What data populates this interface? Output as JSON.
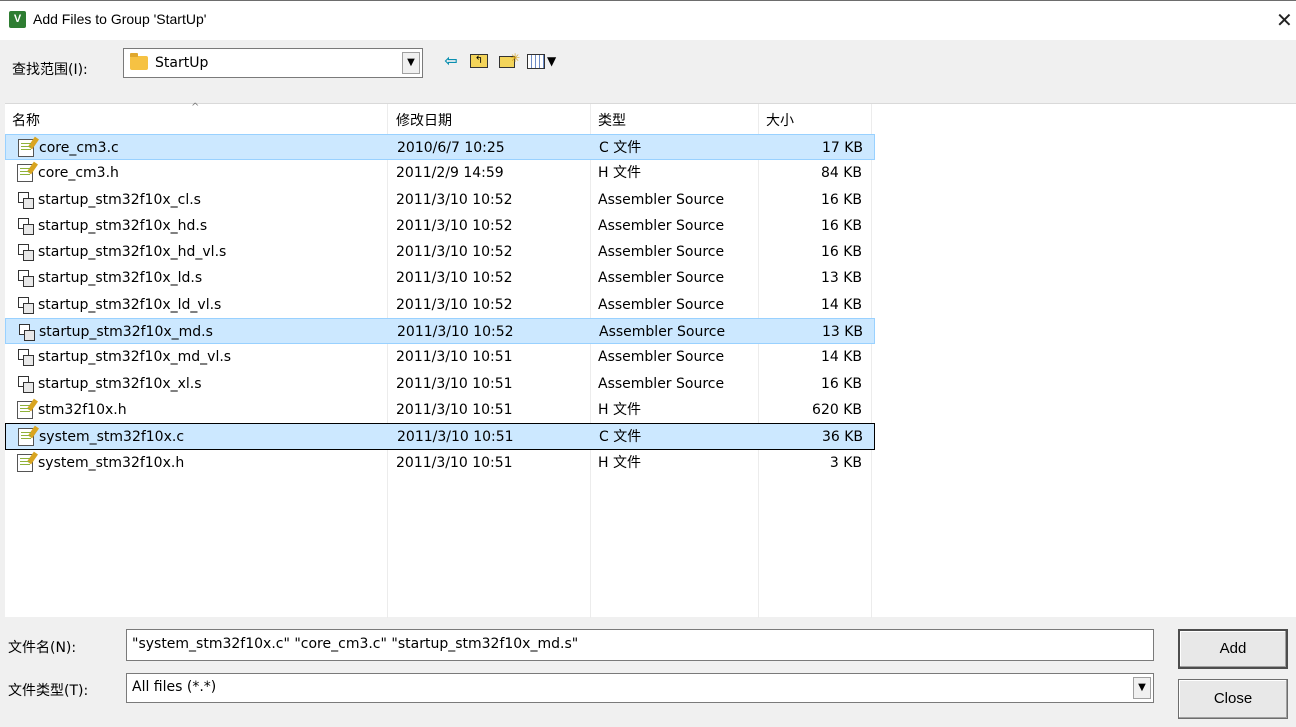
{
  "window": {
    "title": "Add Files to Group 'StartUp'",
    "app_icon_letter": "V",
    "close_glyph": "✕"
  },
  "toolbar": {
    "lookin_label": "查找范围(I):",
    "lookin_value": "StartUp",
    "back_icon": "back-arrow-icon",
    "up_icon": "up-one-level-icon",
    "new_folder_icon": "new-folder-icon",
    "view_icon": "view-menu-icon"
  },
  "columns": {
    "name": "名称",
    "date": "修改日期",
    "type": "类型",
    "size": "大小"
  },
  "files": [
    {
      "name": "core_cm3.c",
      "date": "2010/6/7 10:25",
      "type": "C 文件",
      "size": "17 KB",
      "icon": "c-file",
      "state": "selected"
    },
    {
      "name": "core_cm3.h",
      "date": "2011/2/9 14:59",
      "type": "H 文件",
      "size": "84 KB",
      "icon": "h-file",
      "state": ""
    },
    {
      "name": "startup_stm32f10x_cl.s",
      "date": "2011/3/10 10:52",
      "type": "Assembler Source",
      "size": "16 KB",
      "icon": "asm-file",
      "state": ""
    },
    {
      "name": "startup_stm32f10x_hd.s",
      "date": "2011/3/10 10:52",
      "type": "Assembler Source",
      "size": "16 KB",
      "icon": "asm-file",
      "state": ""
    },
    {
      "name": "startup_stm32f10x_hd_vl.s",
      "date": "2011/3/10 10:52",
      "type": "Assembler Source",
      "size": "16 KB",
      "icon": "asm-file",
      "state": ""
    },
    {
      "name": "startup_stm32f10x_ld.s",
      "date": "2011/3/10 10:52",
      "type": "Assembler Source",
      "size": "13 KB",
      "icon": "asm-file",
      "state": ""
    },
    {
      "name": "startup_stm32f10x_ld_vl.s",
      "date": "2011/3/10 10:52",
      "type": "Assembler Source",
      "size": "14 KB",
      "icon": "asm-file",
      "state": ""
    },
    {
      "name": "startup_stm32f10x_md.s",
      "date": "2011/3/10 10:52",
      "type": "Assembler Source",
      "size": "13 KB",
      "icon": "asm-file",
      "state": "selected"
    },
    {
      "name": "startup_stm32f10x_md_vl.s",
      "date": "2011/3/10 10:51",
      "type": "Assembler Source",
      "size": "14 KB",
      "icon": "asm-file",
      "state": ""
    },
    {
      "name": "startup_stm32f10x_xl.s",
      "date": "2011/3/10 10:51",
      "type": "Assembler Source",
      "size": "16 KB",
      "icon": "asm-file",
      "state": ""
    },
    {
      "name": "stm32f10x.h",
      "date": "2011/3/10 10:51",
      "type": "H 文件",
      "size": "620 KB",
      "icon": "h-file",
      "state": ""
    },
    {
      "name": "system_stm32f10x.c",
      "date": "2011/3/10 10:51",
      "type": "C 文件",
      "size": "36 KB",
      "icon": "c-file",
      "state": "focused"
    },
    {
      "name": "system_stm32f10x.h",
      "date": "2011/3/10 10:51",
      "type": "H 文件",
      "size": "3 KB",
      "icon": "h-file",
      "state": ""
    }
  ],
  "bottom": {
    "filename_label": "文件名(N):",
    "filename_value": "\"system_stm32f10x.c\" \"core_cm3.c\" \"startup_stm32f10x_md.s\"",
    "filetype_label": "文件类型(T):",
    "filetype_value": "All files (*.*)",
    "add_button": "Add",
    "close_button": "Close"
  },
  "colors": {
    "selection": "#cce8ff",
    "selection_border": "#99d1ff"
  }
}
